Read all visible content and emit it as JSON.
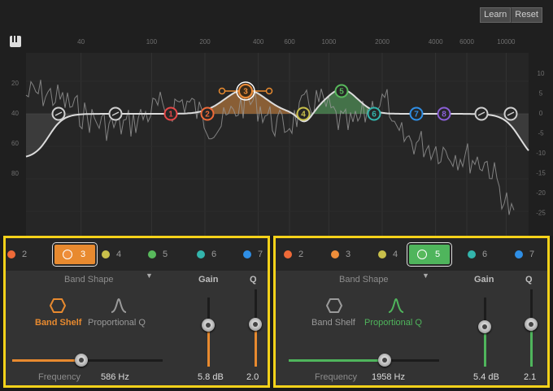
{
  "header": {
    "learn_label": "Learn",
    "reset_label": "Reset"
  },
  "eq_display": {
    "freq_labels": [
      "40",
      "100",
      "200",
      "400",
      "600",
      "1000",
      "2000",
      "4000",
      "6000",
      "10000"
    ],
    "left_scale": [
      "20",
      "40",
      "60",
      "80"
    ],
    "right_scale": [
      "10",
      "5",
      "0",
      "-5",
      "-10",
      "-15",
      "-20",
      "-25"
    ],
    "nodes": [
      {
        "label": "",
        "color": "#cfcfcf",
        "type": "shelf"
      },
      {
        "label": "",
        "color": "#cfcfcf",
        "type": "shelf"
      },
      {
        "label": "1",
        "color": "#e64848"
      },
      {
        "label": "2",
        "color": "#ef6a38"
      },
      {
        "label": "3",
        "color": "#ef8e3a"
      },
      {
        "label": "4",
        "color": "#c9c04b"
      },
      {
        "label": "5",
        "color": "#58b95c"
      },
      {
        "label": "6",
        "color": "#33b5ac"
      },
      {
        "label": "7",
        "color": "#2f8fe6"
      },
      {
        "label": "8",
        "color": "#8a5fd6"
      },
      {
        "label": "",
        "color": "#cfcfcf",
        "type": "shelf"
      },
      {
        "label": "",
        "color": "#cfcfcf",
        "type": "shelf"
      }
    ]
  },
  "colors": {
    "orange": "#e88a2f",
    "green": "#4fb55c",
    "highlight": "#f5d21a"
  },
  "panels": [
    {
      "tabs": [
        {
          "label": "2",
          "color": "#ef6a38"
        },
        {
          "label": "3",
          "color": "#ef8e3a",
          "active": true
        },
        {
          "label": "4",
          "color": "#c9c04b"
        },
        {
          "label": "5",
          "color": "#58b95c"
        },
        {
          "label": "6",
          "color": "#33b5ac"
        },
        {
          "label": "7",
          "color": "#2f8fe6"
        }
      ],
      "band_shape_label": "Band Shape",
      "shapes": [
        "Band Shelf",
        "Proportional Q"
      ],
      "selected_shape": "Band Shelf",
      "gain_label": "Gain",
      "q_label": "Q",
      "frequency_label": "Frequency",
      "frequency_value": "586 Hz",
      "gain_value": "5.8 dB",
      "q_value": "2.0",
      "frequency_level": 0.46,
      "gain_level": 0.6,
      "q_level": 0.55
    },
    {
      "tabs": [
        {
          "label": "2",
          "color": "#ef6a38"
        },
        {
          "label": "3",
          "color": "#ef8e3a"
        },
        {
          "label": "4",
          "color": "#c9c04b"
        },
        {
          "label": "5",
          "color": "#58b95c",
          "active": true
        },
        {
          "label": "6",
          "color": "#33b5ac"
        },
        {
          "label": "7",
          "color": "#2f8fe6"
        }
      ],
      "band_shape_label": "Band Shape",
      "shapes": [
        "Band Shelf",
        "Proportional Q"
      ],
      "selected_shape": "Proportional Q",
      "gain_label": "Gain",
      "q_label": "Q",
      "frequency_label": "Frequency",
      "frequency_value": "1958 Hz",
      "gain_value": "5.4 dB",
      "q_value": "2.1",
      "frequency_level": 0.64,
      "gain_level": 0.58,
      "q_level": 0.55
    }
  ]
}
